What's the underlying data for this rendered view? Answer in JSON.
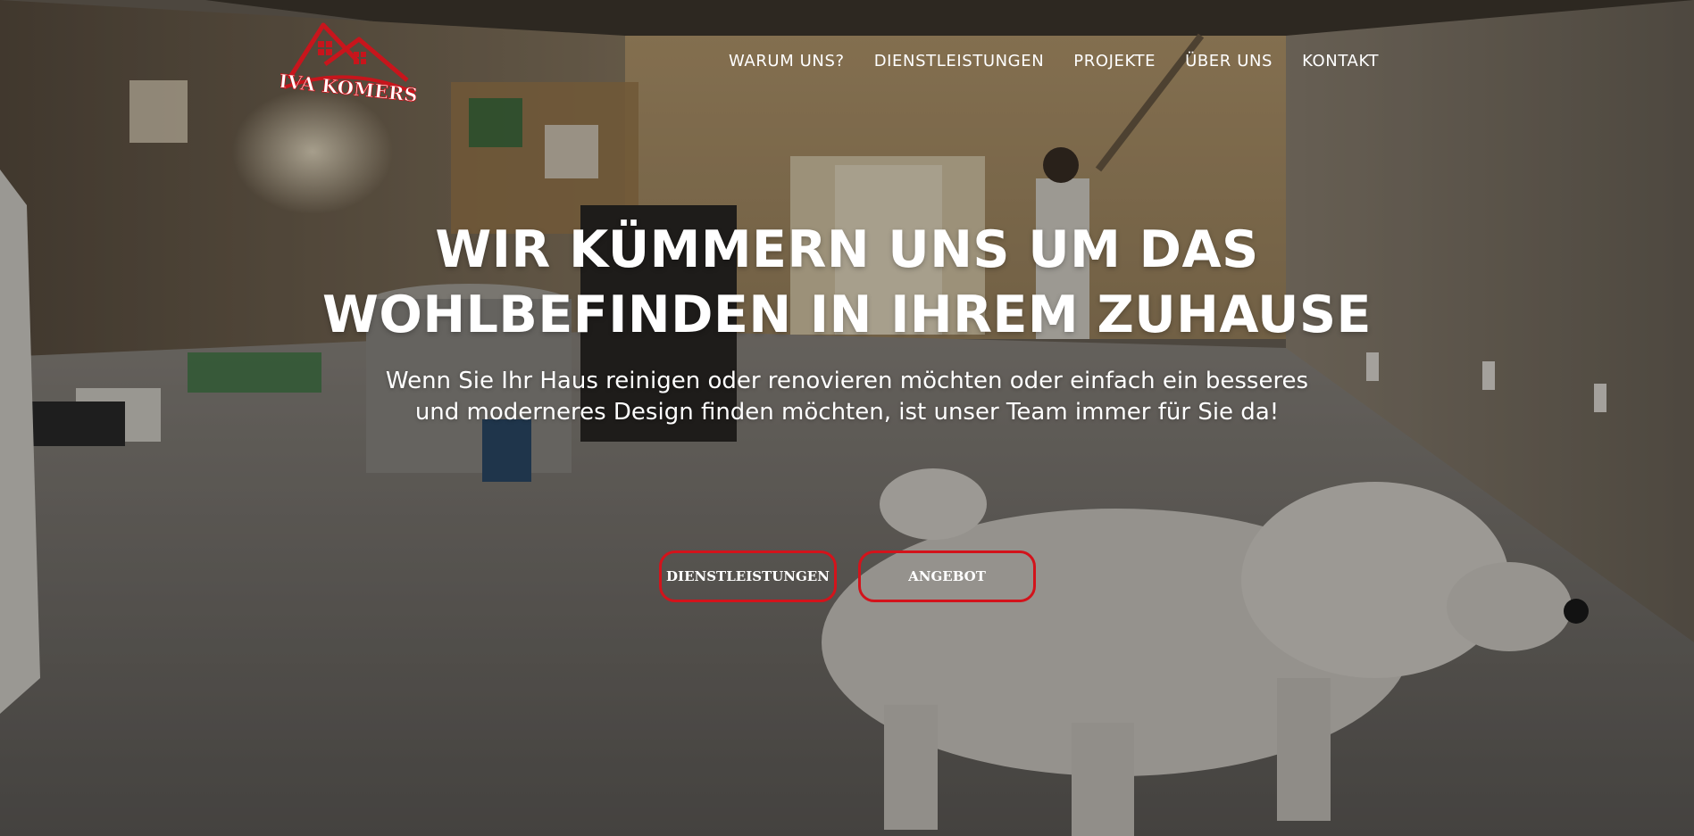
{
  "brand": {
    "name": "IVA KOMERS",
    "logo_icon": "house-roof-icon",
    "accent_color": "#d3131b"
  },
  "nav": {
    "items": [
      {
        "label": "WARUM UNS?"
      },
      {
        "label": "DIENSTLEISTUNGEN"
      },
      {
        "label": "PROJEKTE"
      },
      {
        "label": "ÜBER UNS"
      },
      {
        "label": "KONTAKT"
      }
    ]
  },
  "hero": {
    "headline_line1": "WIR KÜMMERN UNS UM DAS",
    "headline_line2": "WOHLBEFINDEN IN IHREM ZUHAUSE",
    "subline": "Wenn Sie Ihr Haus reinigen oder renovieren möchten oder einfach ein besseres und moderneres Design finden möchten, ist unser Team immer für Sie da!",
    "background": "renovation-room-with-painter-and-white-dog-photo"
  },
  "buttons": {
    "services_label": "DIENSTLEISTUNGEN",
    "offer_label": "ANGEBOT"
  }
}
